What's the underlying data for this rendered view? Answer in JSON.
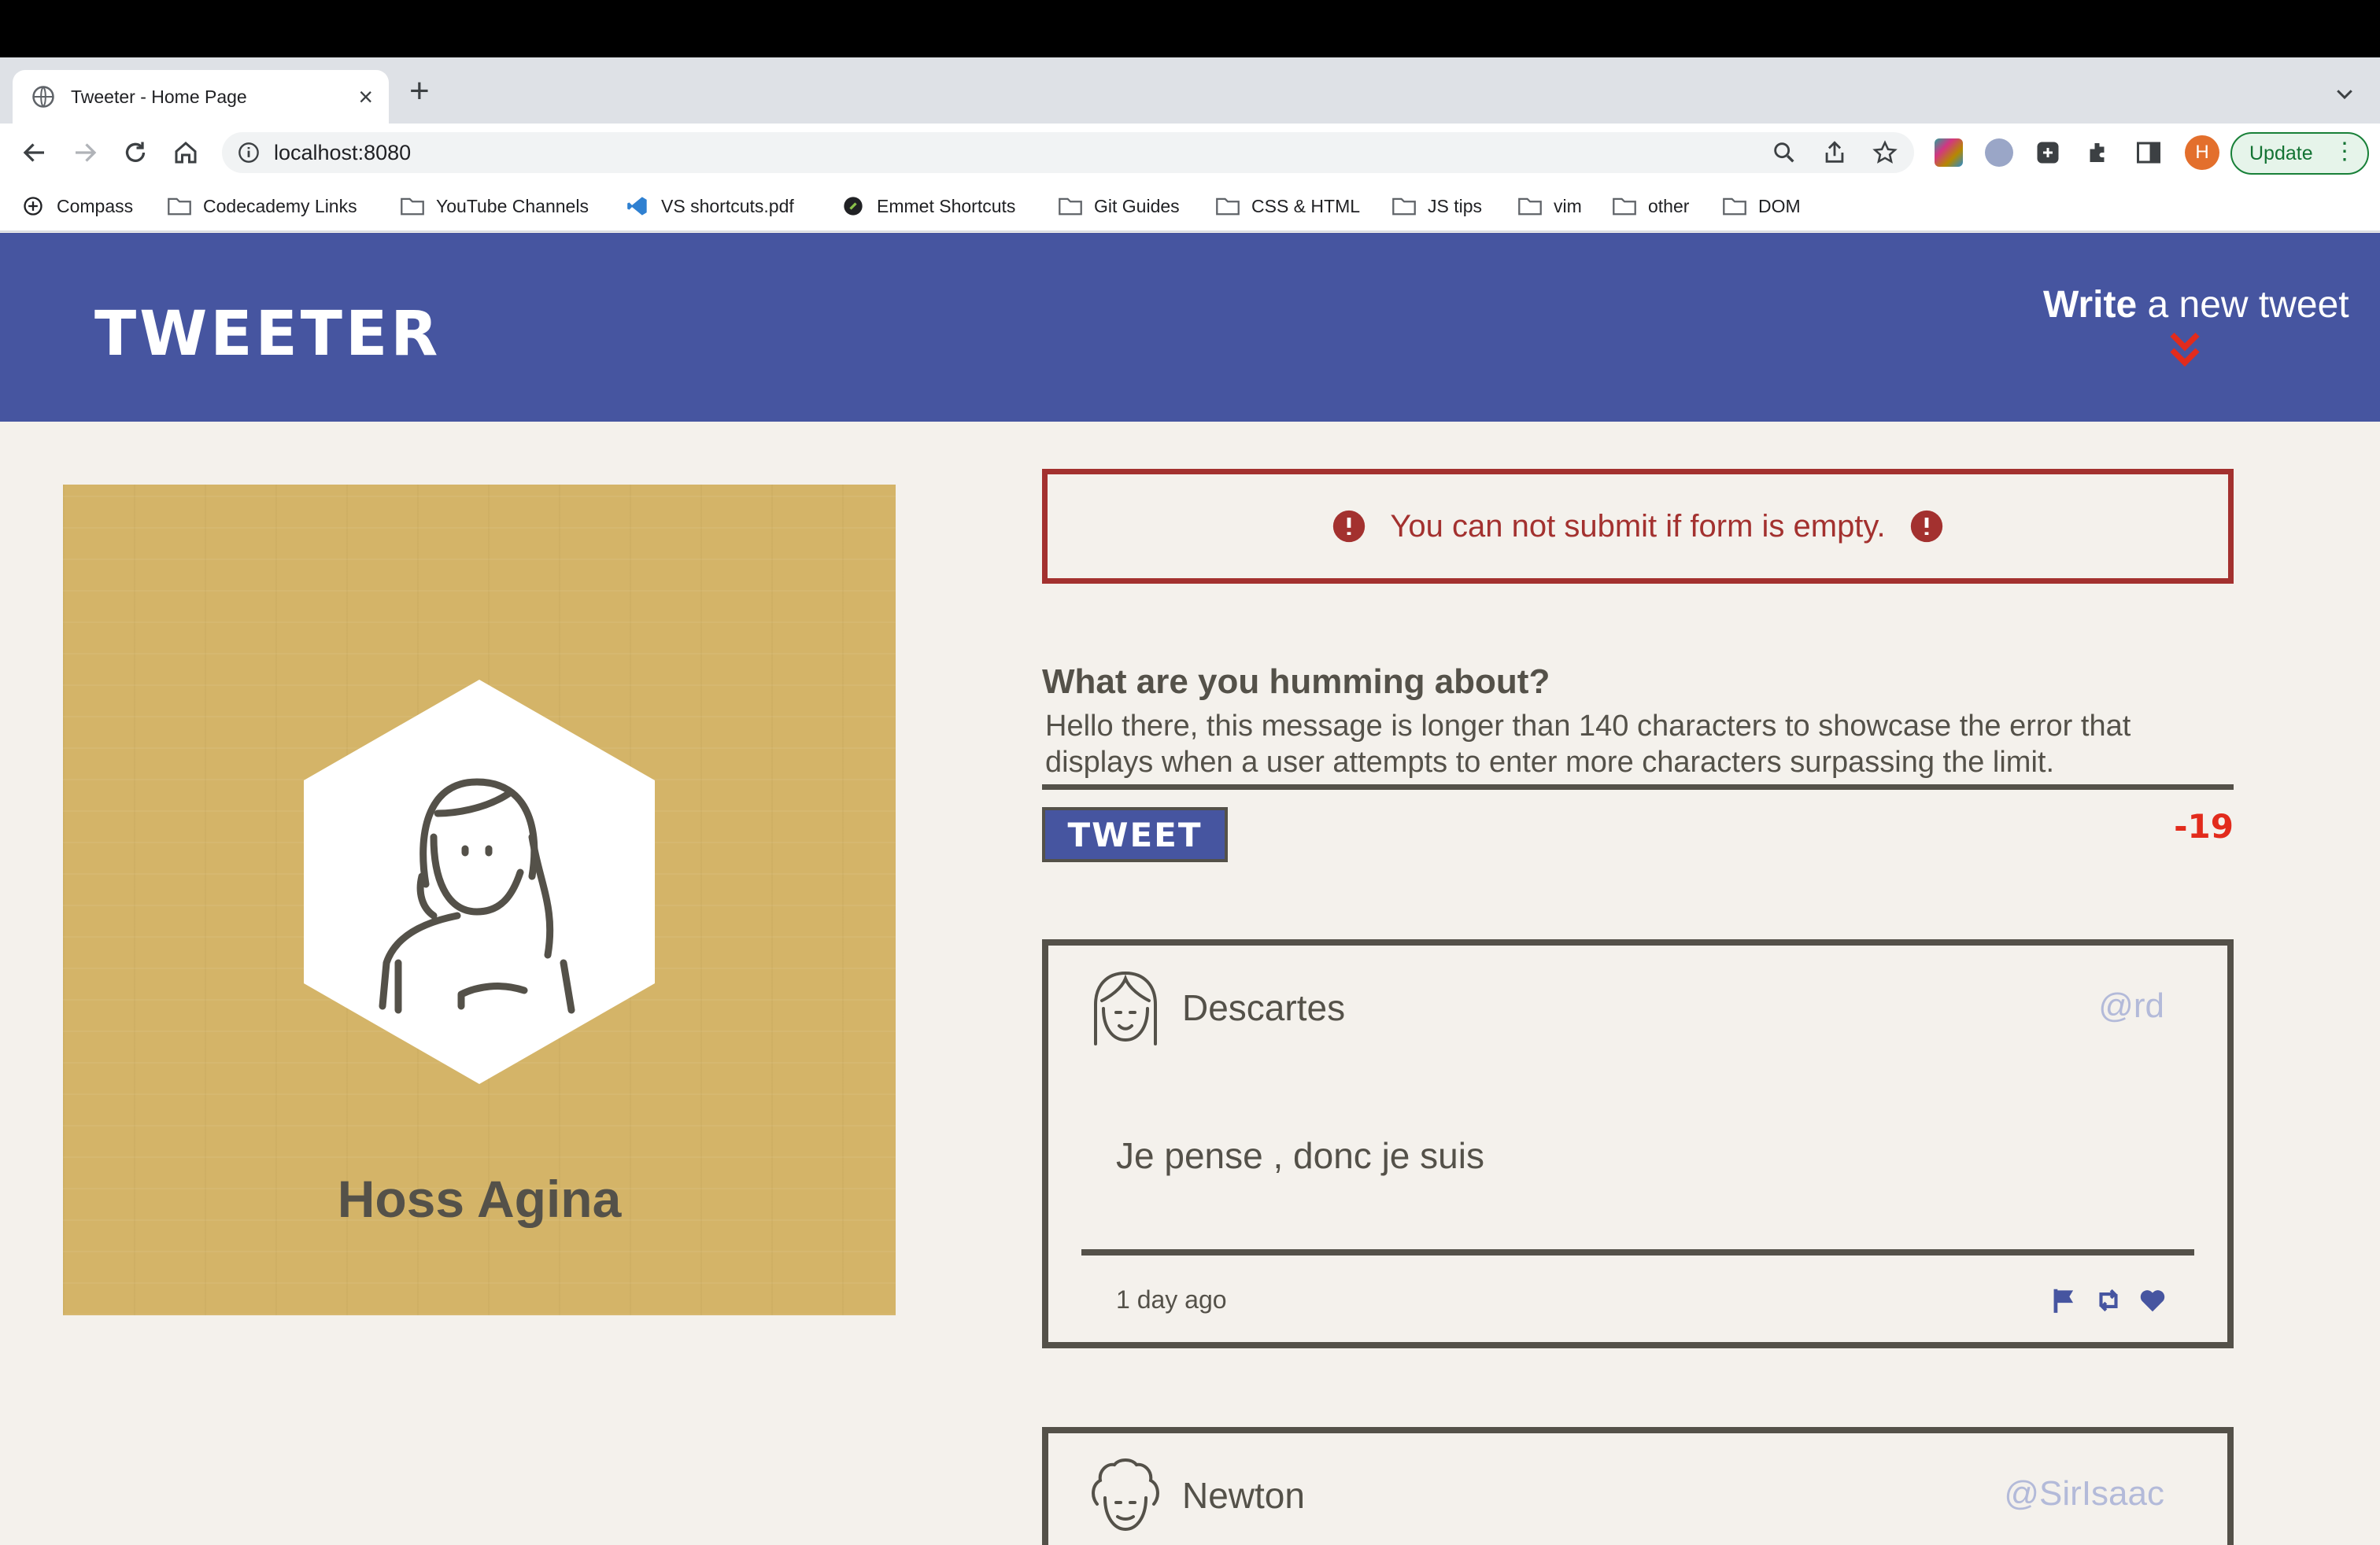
{
  "browser": {
    "tab_title": "Tweeter - Home Page",
    "tab_close": "×",
    "new_tab": "+",
    "url": "localhost:8080",
    "profile_initial": "H",
    "update_label": "Update",
    "bookmarks": [
      "Compass",
      "Codecademy Links",
      "YouTube Channels",
      "VS shortcuts.pdf",
      "Emmet Shortcuts",
      "Git Guides",
      "CSS & HTML",
      "JS tips",
      "vim",
      "other",
      "DOM"
    ]
  },
  "nav": {
    "brand": "TWEETER",
    "write_bold": "Write",
    "write_rest": " a new tweet"
  },
  "profile": {
    "name": "Hoss Agina"
  },
  "error": {
    "message": "You can not submit if form is empty."
  },
  "compose": {
    "prompt": "What are you humming about?",
    "text": "Hello there, this message is longer than 140 characters to showcase the error that displays when a user attempts to enter more characters surpassing the limit.",
    "button": "TWEET",
    "counter": "-19"
  },
  "tweets": [
    {
      "name": "Descartes",
      "handle": "@rd",
      "body": "Je pense , donc je suis",
      "time": "1 day ago"
    },
    {
      "name": "Newton",
      "handle": "@SirIsaac"
    }
  ],
  "colors": {
    "nav_bg": "#4655a0",
    "page_bg": "#f4f1ec",
    "error": "#a3312f",
    "counter_error": "#e22b1c",
    "text": "#545149",
    "profile_bg": "#d4b468"
  }
}
